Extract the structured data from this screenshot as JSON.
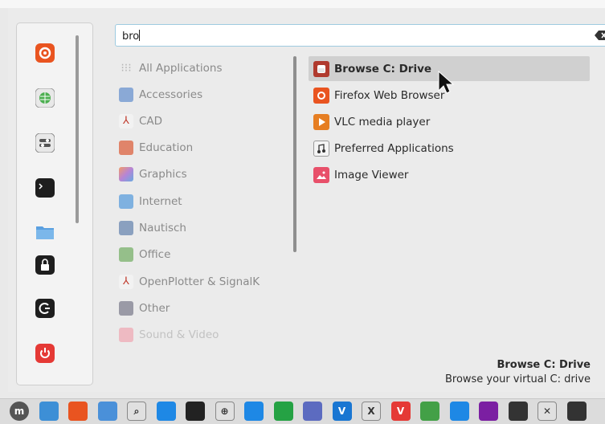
{
  "search": {
    "value": "bro"
  },
  "favorites": [
    {
      "name": "firefox-icon",
      "color": "#e95420"
    },
    {
      "name": "software-manager-icon",
      "color": "#4caf50"
    },
    {
      "name": "system-settings-icon",
      "color": "#607d8b"
    },
    {
      "name": "terminal-icon",
      "color": "#222222"
    },
    {
      "name": "files-icon",
      "color": "#4a90d9"
    },
    {
      "name": "lock-screen-icon",
      "color": "#222222"
    },
    {
      "name": "logout-icon",
      "color": "#222222"
    },
    {
      "name": "power-icon",
      "color": "#e53935"
    }
  ],
  "categories": [
    {
      "label": "All Applications",
      "icon": "grid-icon",
      "color": "#cfcfcf"
    },
    {
      "label": "Accessories",
      "icon": "accessories-icon",
      "color": "#8aa9d6"
    },
    {
      "label": "CAD",
      "icon": "cad-icon",
      "color": "#f2f2f2"
    },
    {
      "label": "Education",
      "icon": "education-icon",
      "color": "#e0846a"
    },
    {
      "label": "Graphics",
      "icon": "graphics-icon",
      "color": "#b685d6"
    },
    {
      "label": "Internet",
      "icon": "internet-icon",
      "color": "#7fb1e0"
    },
    {
      "label": "Nautisch",
      "icon": "nautisch-icon",
      "color": "#8aa0bf"
    },
    {
      "label": "Office",
      "icon": "office-icon",
      "color": "#95bf8a"
    },
    {
      "label": "OpenPlotter & SignalK",
      "icon": "openplotter-icon",
      "color": "#f2f2f2"
    },
    {
      "label": "Other",
      "icon": "other-icon",
      "color": "#9a9aa6"
    },
    {
      "label": "Sound & Video",
      "icon": "sound-video-icon",
      "color": "#f09aa6"
    }
  ],
  "apps": [
    {
      "label": "Browse C: Drive",
      "icon": "wine-icon",
      "color": "#c0392b",
      "selected": true
    },
    {
      "label": "Firefox Web Browser",
      "icon": "firefox-icon",
      "color": "#e95420"
    },
    {
      "label": "VLC media player",
      "icon": "vlc-icon",
      "color": "#e67e22"
    },
    {
      "label": "Preferred Applications",
      "icon": "preferred-apps-icon",
      "color": "#f4f4f4"
    },
    {
      "label": "Image Viewer",
      "icon": "image-viewer-icon",
      "color": "#e8506a"
    }
  ],
  "description": {
    "title": "Browse C: Drive",
    "subtitle": "Browse your virtual C: drive"
  },
  "taskbar": [
    {
      "name": "menu-icon",
      "color": "#555555",
      "glyph": "m"
    },
    {
      "name": "show-desktop-icon",
      "color": "#3d8fd6",
      "glyph": ""
    },
    {
      "name": "firefox-icon",
      "color": "#e95420",
      "glyph": ""
    },
    {
      "name": "files-icon",
      "color": "#4a90d9",
      "glyph": ""
    },
    {
      "name": "search-icon",
      "color": "#e0e0e0",
      "glyph": "⌕"
    },
    {
      "name": "app-grid-icon",
      "color": "#1e88e5",
      "glyph": ""
    },
    {
      "name": "terminal-icon",
      "color": "#222222",
      "glyph": ""
    },
    {
      "name": "crosshair-icon",
      "color": "#e0e0e0",
      "glyph": "⊕"
    },
    {
      "name": "notes-icon",
      "color": "#1e88e5",
      "glyph": ""
    },
    {
      "name": "whatsapp-icon",
      "color": "#25a244",
      "glyph": ""
    },
    {
      "name": "network-icon",
      "color": "#5c6bc0",
      "glyph": ""
    },
    {
      "name": "vscode-icon",
      "color": "#1976d2",
      "glyph": "V"
    },
    {
      "name": "close-x-icon",
      "color": "#e0e0e0",
      "glyph": "X"
    },
    {
      "name": "vivaldi-icon",
      "color": "#e53935",
      "glyph": "V"
    },
    {
      "name": "chrome-icon",
      "color": "#43a047",
      "glyph": ""
    },
    {
      "name": "bluetooth-icon",
      "color": "#1e88e5",
      "glyph": ""
    },
    {
      "name": "firefox-dev-icon",
      "color": "#7b1fa2",
      "glyph": ""
    },
    {
      "name": "app-dark-icon",
      "color": "#333333",
      "glyph": ""
    },
    {
      "name": "xbox-icon",
      "color": "#e0e0e0",
      "glyph": "✕"
    },
    {
      "name": "app-dark-2-icon",
      "color": "#333333",
      "glyph": ""
    }
  ]
}
